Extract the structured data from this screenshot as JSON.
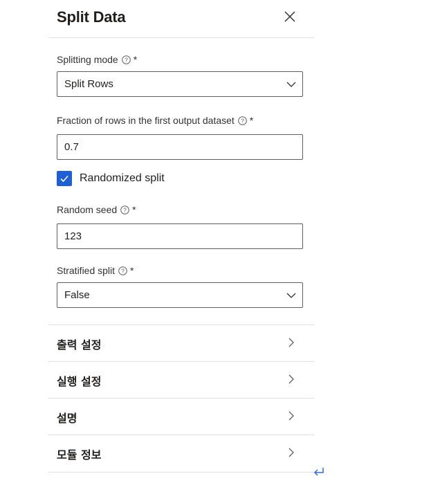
{
  "panel": {
    "title": "Split Data",
    "close_icon": "close-icon"
  },
  "fields": {
    "splitting_mode": {
      "label": "Splitting mode",
      "required": "*",
      "value": "Split Rows"
    },
    "fraction": {
      "label": "Fraction of rows in the first output dataset",
      "required": "*",
      "value": "0.7"
    },
    "randomized": {
      "label": "Randomized split",
      "checked": true
    },
    "random_seed": {
      "label": "Random seed",
      "required": "*",
      "value": "123"
    },
    "stratified": {
      "label": "Stratified split",
      "required": "*",
      "value": "False"
    }
  },
  "sections": [
    {
      "label": "출력 설정"
    },
    {
      "label": "실행 설정"
    },
    {
      "label": "설명"
    },
    {
      "label": "모듈 정보"
    }
  ],
  "colors": {
    "accent": "#1f5fd6",
    "border": "#605e5c",
    "divider": "#e1dfdd",
    "enter_icon": "#2b6cd4"
  },
  "icons": [
    "close-icon",
    "help-icon",
    "chevron-down-icon",
    "checkmark-icon",
    "chevron-right-icon",
    "enter-arrow-icon"
  ]
}
